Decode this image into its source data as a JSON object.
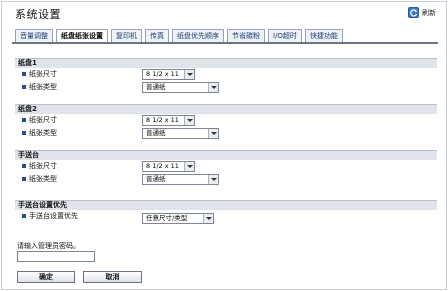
{
  "header": {
    "title": "系统设置",
    "refresh_label": "刷新"
  },
  "tabs": [
    {
      "label": "音量调整"
    },
    {
      "label": "纸盘纸张设置"
    },
    {
      "label": "复印机"
    },
    {
      "label": "传真"
    },
    {
      "label": "纸盘优先顺序"
    },
    {
      "label": "节省碳粉"
    },
    {
      "label": "I/O超时"
    },
    {
      "label": "快捷功能"
    }
  ],
  "sections": [
    {
      "title": "纸盘1",
      "rows": [
        {
          "label": "纸张尺寸",
          "value": "8 1/2 x 11"
        },
        {
          "label": "纸张类型",
          "value": "普通纸"
        }
      ]
    },
    {
      "title": "纸盘2",
      "rows": [
        {
          "label": "纸张尺寸",
          "value": "8 1/2 x 11"
        },
        {
          "label": "纸张类型",
          "value": "普通纸"
        }
      ]
    },
    {
      "title": "手送台",
      "rows": [
        {
          "label": "纸张尺寸",
          "value": "8 1/2 x 11"
        },
        {
          "label": "纸张类型",
          "value": "普通纸"
        }
      ]
    },
    {
      "title": "手送台设置优先",
      "rows": [
        {
          "label": "手送台设置优先",
          "value": "任意尺寸/类型"
        }
      ]
    }
  ],
  "password": {
    "label": "请输入管理员密码。",
    "value": ""
  },
  "buttons": {
    "ok": "确定",
    "cancel": "取消"
  }
}
